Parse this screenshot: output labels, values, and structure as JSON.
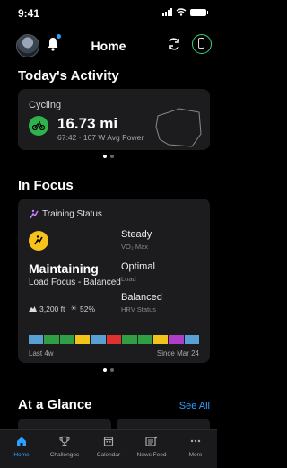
{
  "status_bar": {
    "time": "9:41"
  },
  "nav": {
    "title": "Home"
  },
  "activity": {
    "section_title": "Today's Activity",
    "label": "Cycling",
    "distance": "16.73 mi",
    "detail": "67:42 · 167 W Avg Power"
  },
  "focus": {
    "section_title": "In Focus",
    "header": "Training Status",
    "status": "Maintaining",
    "load_focus": "Load Focus - Balanced",
    "altitude": "3,200 ft",
    "heat": "52%",
    "metrics": [
      {
        "value": "Steady",
        "label": "VO₂ Max"
      },
      {
        "value": "Optimal",
        "label": "Load"
      },
      {
        "value": "Balanced",
        "label": "HRV Status"
      }
    ],
    "bar_colors": [
      "#5a9fd4",
      "#2f9e44",
      "#2f9e44",
      "#f0c419",
      "#5a9fd4",
      "#e03131",
      "#2f9e44",
      "#2f9e44",
      "#f0c419",
      "#ae3ec9",
      "#5a9fd4"
    ],
    "period_left": "Last 4w",
    "period_right": "Since Mar 24"
  },
  "glance": {
    "section_title": "At a Glance",
    "see_all": "See All"
  },
  "tabs": [
    {
      "label": "Home",
      "icon": "home-icon"
    },
    {
      "label": "Challenges",
      "icon": "challenges-icon"
    },
    {
      "label": "Calendar",
      "icon": "calendar-icon"
    },
    {
      "label": "News Feed",
      "icon": "news-feed-icon"
    },
    {
      "label": "More",
      "icon": "more-icon"
    }
  ],
  "colors": {
    "accent": "#2ea0ff",
    "activity_green": "#2fb24c",
    "status_yellow": "#f6c21b",
    "card": "#1c1c1e"
  }
}
